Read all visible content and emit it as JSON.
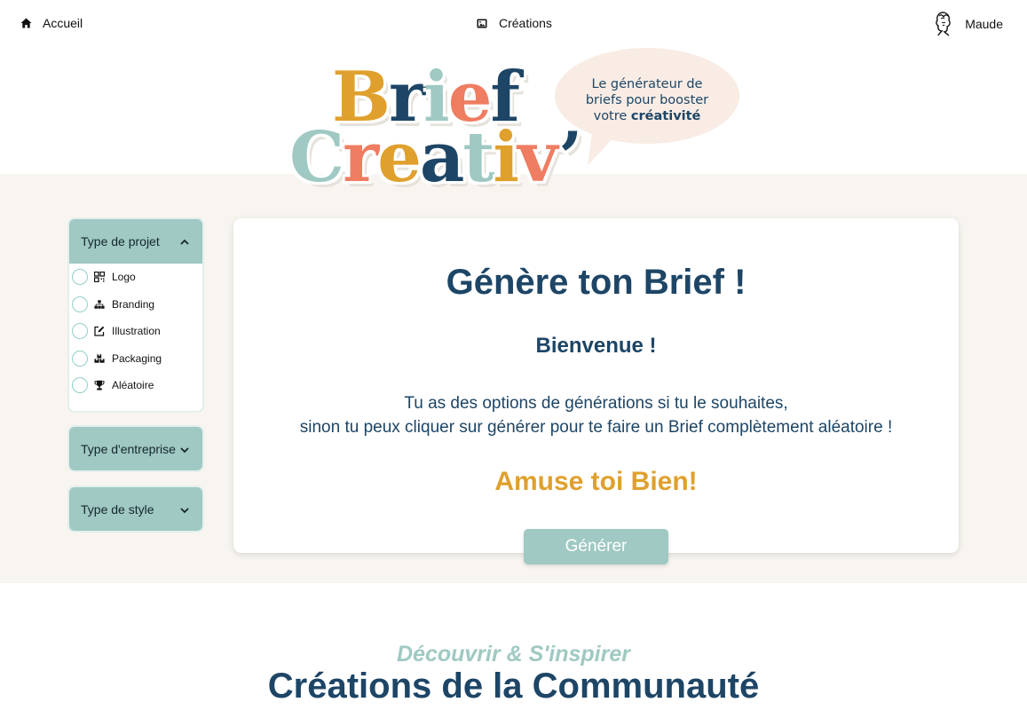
{
  "nav": {
    "home_label": "Accueil",
    "creations_label": "Créations",
    "user_label": "Maude",
    "icons": {
      "home": "home-icon",
      "creations": "image-icon",
      "user": "avatar-sketch"
    }
  },
  "logo": {
    "line1": [
      "B",
      "r",
      "i",
      "e",
      "f"
    ],
    "line2": [
      "C",
      "r",
      "e",
      "a",
      "t",
      "i",
      "v",
      "’"
    ],
    "colors": {
      "orange": "#e0a02d",
      "navy": "#1d4566",
      "coral": "#ef7d61",
      "teal": "#9fc9c2"
    },
    "tagline_line1": "Le générateur de",
    "tagline_line2": "briefs pour booster",
    "tagline_line3_prefix": "votre",
    "tagline_line3_bold": "créativité"
  },
  "sidebar": {
    "project": {
      "title": "Type de projet",
      "expanded": true,
      "options": [
        {
          "label": "Logo",
          "icon": "qr-icon",
          "checked": false
        },
        {
          "label": "Branding",
          "icon": "sitemap-icon",
          "checked": false
        },
        {
          "label": "Illustration",
          "icon": "edit-icon",
          "checked": false
        },
        {
          "label": "Packaging",
          "icon": "boxes-icon",
          "checked": false
        },
        {
          "label": "Aléatoire",
          "icon": "trophy-icon",
          "checked": false
        }
      ]
    },
    "company": {
      "title": "Type d'entreprise",
      "expanded": false
    },
    "style": {
      "title": "Type de style",
      "expanded": false
    }
  },
  "card": {
    "title": "Génère ton Brief !",
    "welcome": "Bienvenue !",
    "desc_line1": "Tu as des options de générations si tu le souhaites,",
    "desc_line2": "sinon tu peux cliquer sur générer pour te faire un Brief complètement aléatoire !",
    "fun": "Amuse toi Bien!",
    "button_label": "Générer"
  },
  "community": {
    "kicker": "Découvrir & S'inspirer",
    "title": "Créations de la Communauté"
  },
  "theme": {
    "accent_teal": "#9fc9c2",
    "navy": "#1d4566",
    "orange": "#e0a02d",
    "band_bg": "#f8f5f0"
  }
}
